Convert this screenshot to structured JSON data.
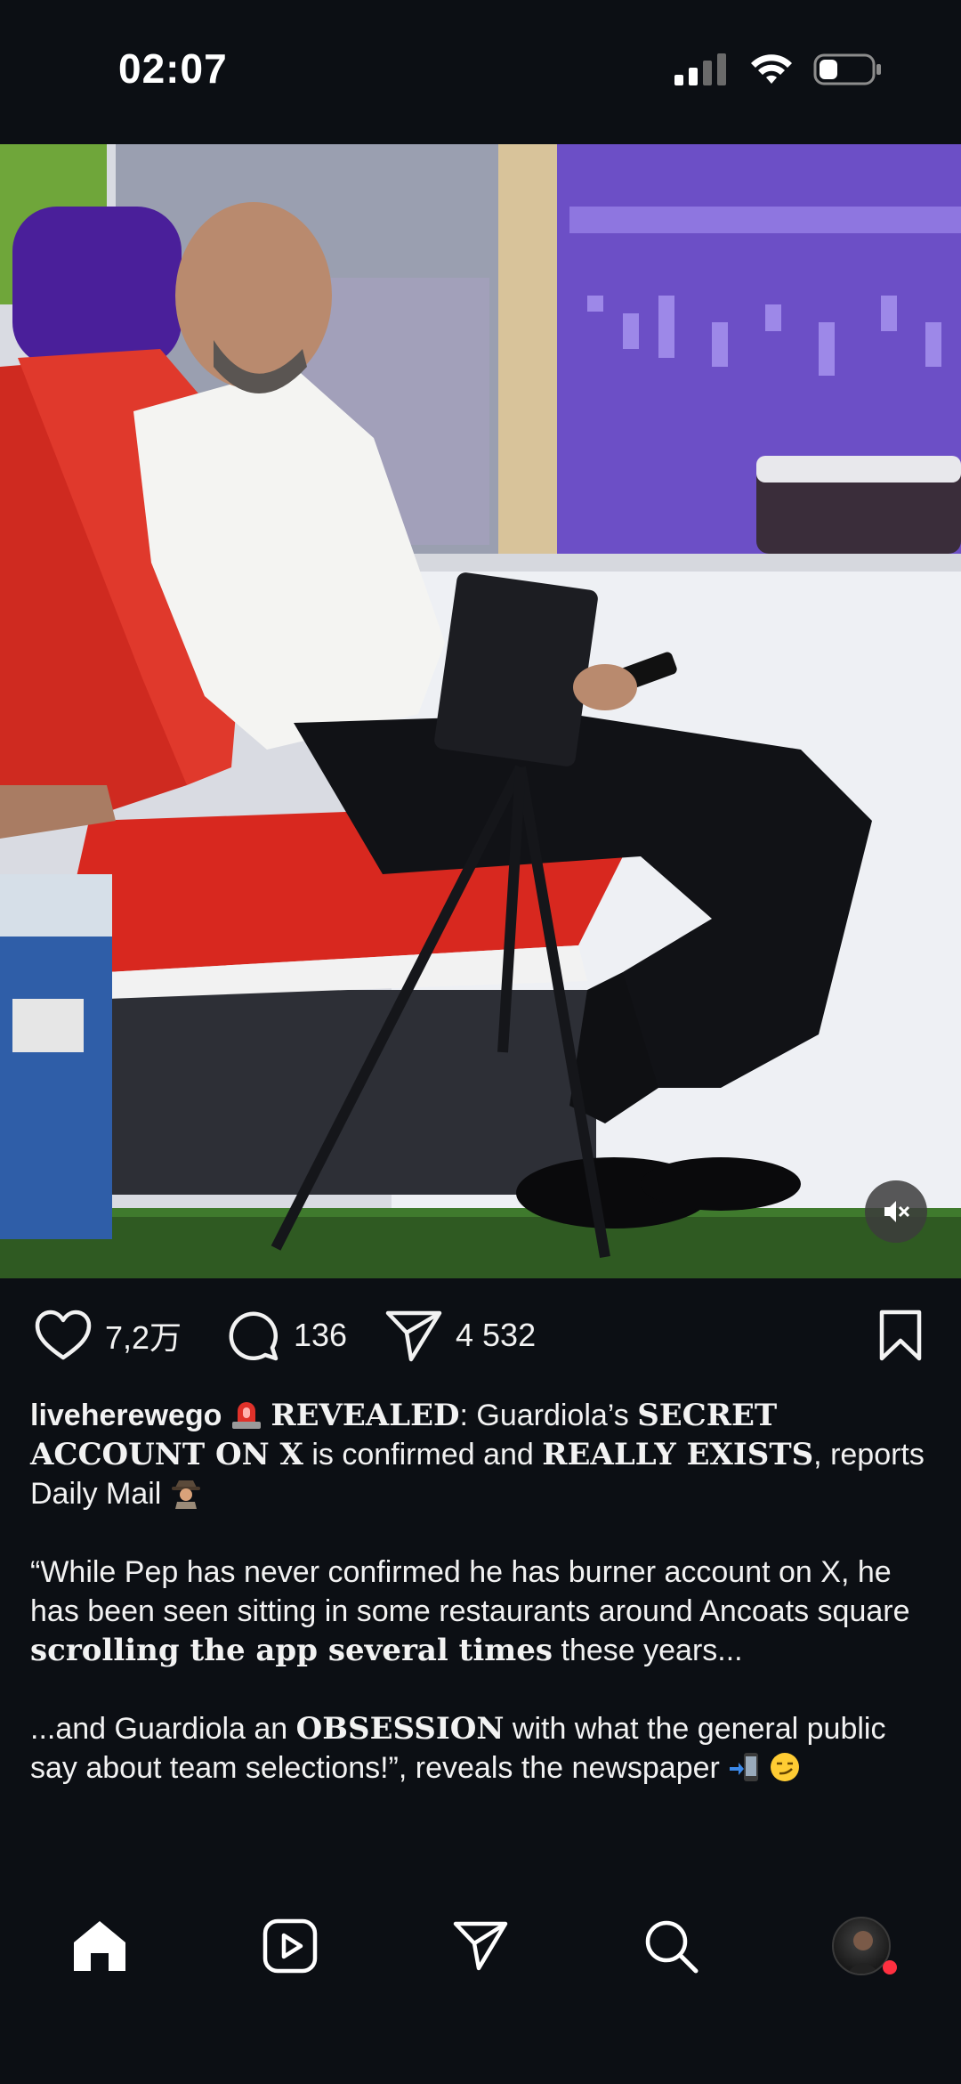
{
  "status_bar": {
    "time": "02:07",
    "icons": [
      "cellular-signal-icon",
      "wifi-icon",
      "battery-icon"
    ]
  },
  "post": {
    "media_description": "photo",
    "likes": "7,2万",
    "comments": "136",
    "shares": "4 532",
    "caption": {
      "username": "liveherewego",
      "line1_pre": "REVEALED",
      "line1_a": ": Guardiola’s ",
      "line1_b": "SECRET ACCOUNT ON X",
      "line1_c": " is confirmed and ",
      "line1_d": "REALLY EXISTS",
      "line1_e": ", reports Daily Mail",
      "p2_a": "“While Pep has never confirmed he has burner account on X, he has been seen sitting in some restaurants around Ancoats square ",
      "p2_b": "scrolling the app several times",
      "p2_c": " these years...",
      "p3_a": "...and Guardiola an ",
      "p3_b": "OBSESSION",
      "p3_c": " with what the general public say about team selections!”, reveals the newspaper"
    }
  },
  "nav": {
    "items": [
      "home-icon",
      "reels-icon",
      "direct-icon",
      "search-icon",
      "profile-avatar"
    ]
  },
  "colors": {
    "background": "#0c0f14",
    "text": "#f2f2f2",
    "notification_dot": "#ff3040",
    "seat_red": "#d8281f"
  }
}
